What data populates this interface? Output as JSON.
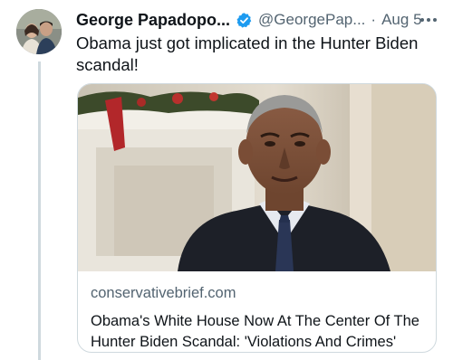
{
  "tweet": {
    "author_name": "George Papadopo...",
    "handle": "@GeorgePap...",
    "separator": "·",
    "time": "Aug 5",
    "text": "Obama just got implicated in the Hunter Biden scandal!"
  },
  "card": {
    "domain": "conservativebrief.com",
    "headline": "Obama's White House Now At The Center Of The Hunter Biden Scandal: 'Violations And Crimes'"
  },
  "colors": {
    "text_primary": "#0f1419",
    "text_secondary": "#536471",
    "verified_blue": "#1d9bf0",
    "border": "#cfd9de"
  },
  "icons": {
    "verified": "verified-badge-icon",
    "more": "more-options-icon"
  }
}
